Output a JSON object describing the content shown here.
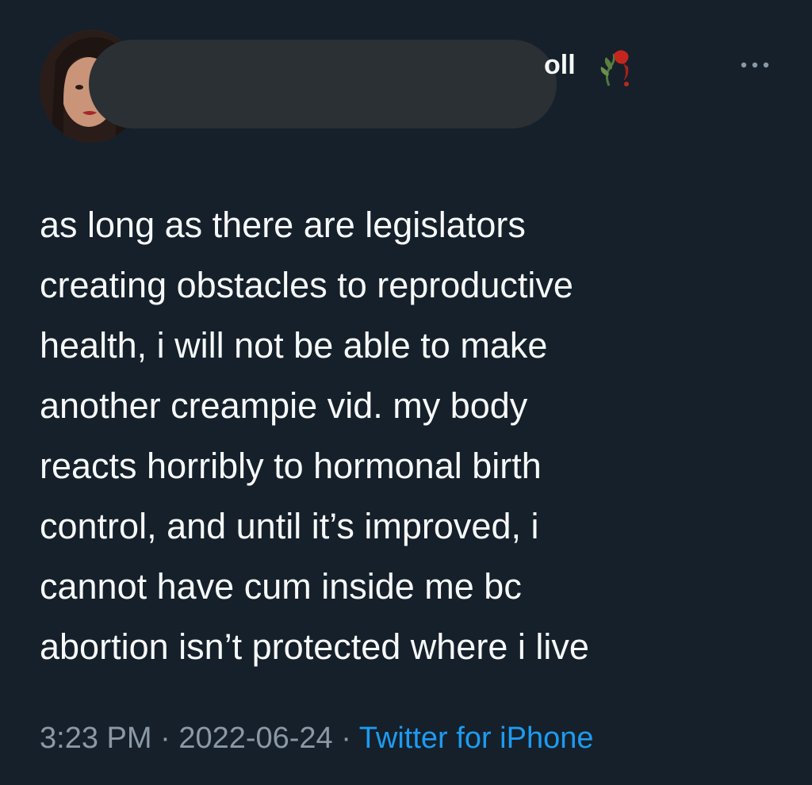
{
  "tweet": {
    "name_visible_fragment": "oll",
    "text": "as long as there are legislators\ncreating obstacles to reproductive\nhealth, i will not be able to make\nanother creampie vid. my body\nreacts horribly to hormonal birth\ncontrol, and until it’s improved, i\ncannot have cum inside me bc\nabortion isn’t protected where i live",
    "time": "3:23 PM",
    "separator": " · ",
    "date": "2022-06-24",
    "source": "Twitter for iPhone"
  },
  "icons": {
    "more": "more-horizontal-icon",
    "name_emoji": "wilted-rose-icon"
  },
  "colors": {
    "background": "#15202b",
    "text": "#f7f9f9",
    "meta": "#8b98a5",
    "link": "#1d9bf0",
    "redaction": "#2b3035"
  }
}
